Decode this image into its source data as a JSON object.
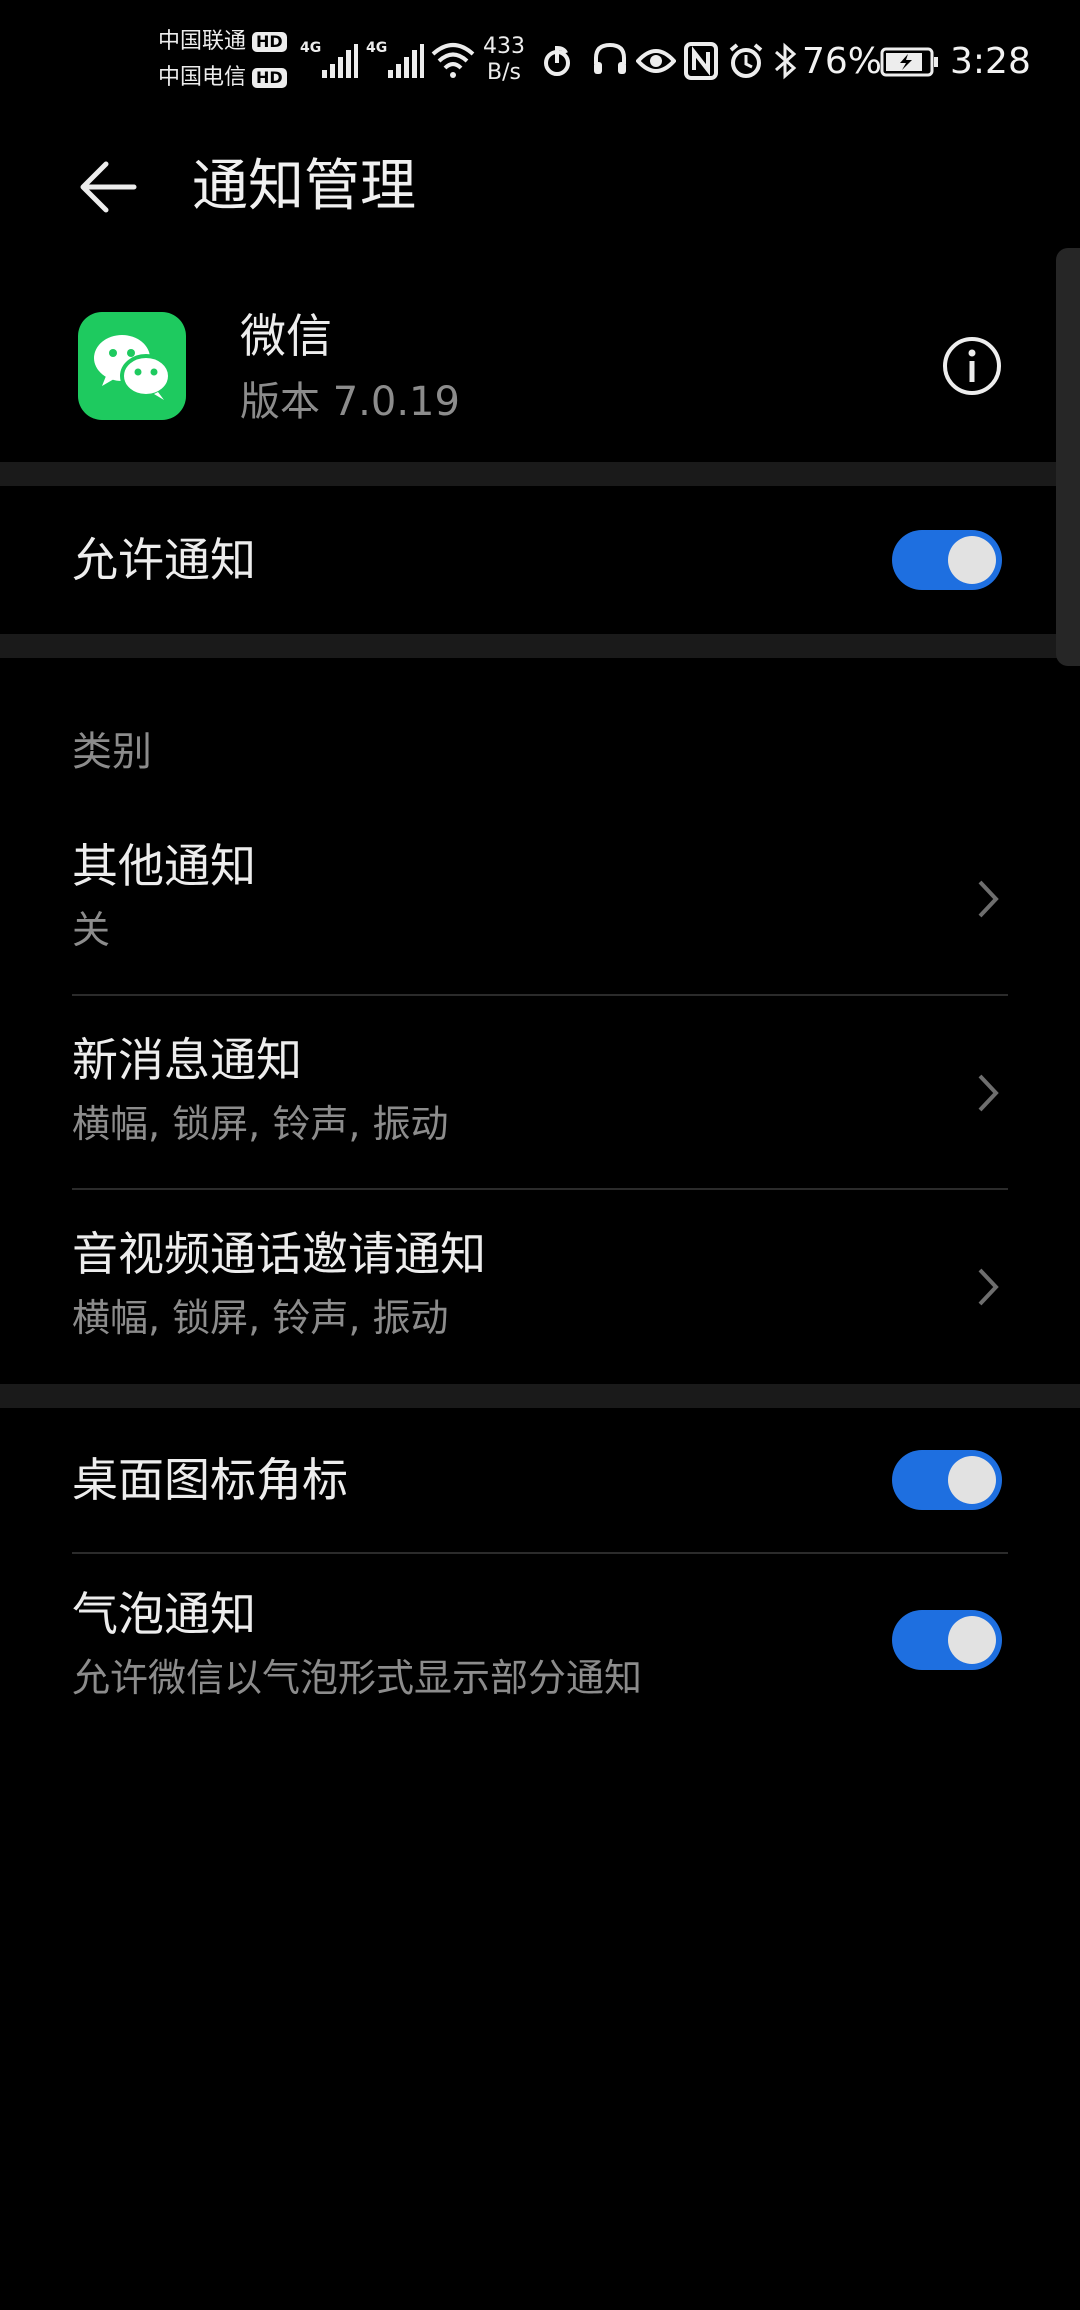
{
  "status_bar": {
    "carrier1": "中国联通",
    "carrier2": "中国电信",
    "hd": "HD",
    "net_type": "4G",
    "speed_value": "433",
    "speed_unit": "B/s",
    "battery": "76%",
    "time": "3:28"
  },
  "header": {
    "title": "通知管理"
  },
  "app": {
    "name": "微信",
    "version": "版本 7.0.19"
  },
  "allow_notifications": {
    "label": "允许通知",
    "on": true
  },
  "category": {
    "header": "类别",
    "items": [
      {
        "title": "其他通知",
        "subtitle": "关"
      },
      {
        "title": "新消息通知",
        "subtitle": "横幅, 锁屏, 铃声, 振动"
      },
      {
        "title": "音视频通话邀请通知",
        "subtitle": "横幅, 锁屏, 铃声, 振动"
      }
    ]
  },
  "badge": {
    "label": "桌面图标角标",
    "on": true
  },
  "bubble": {
    "label": "气泡通知",
    "subtitle": "允许微信以气泡形式显示部分通知",
    "on": true
  },
  "colors": {
    "accent": "#1E6FE0",
    "wechat_green": "#1ECA5F",
    "background": "#000000"
  }
}
